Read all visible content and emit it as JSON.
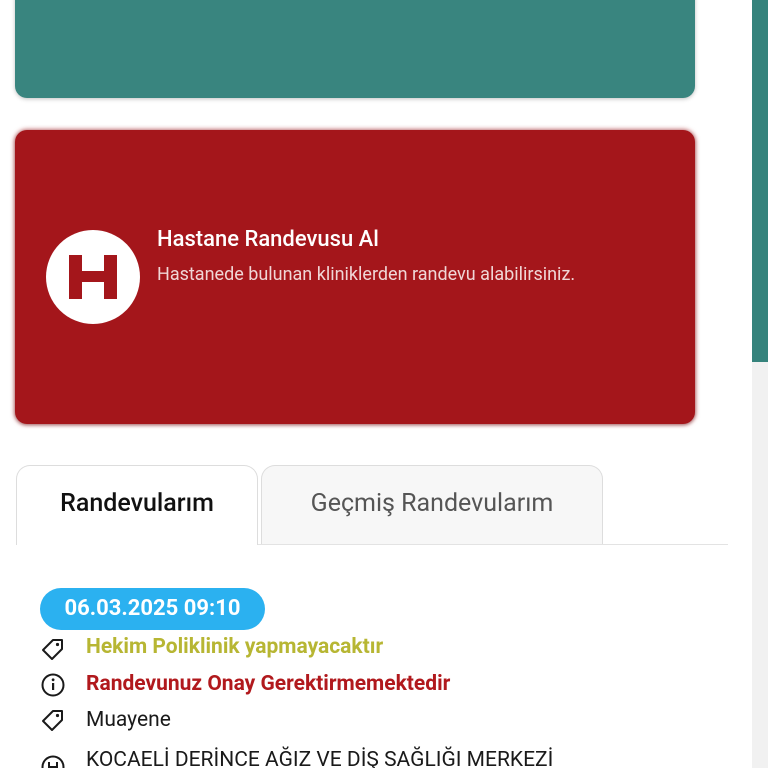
{
  "hospital_card": {
    "title": "Hastane Randevusu Al",
    "subtitle": "Hastanede bulunan kliniklerden randevu alabilirsiniz.",
    "icon": "hospital-h-icon"
  },
  "tabs": [
    {
      "label": "Randevularım",
      "active": true
    },
    {
      "label": "Geçmiş Randevularım",
      "active": false
    }
  ],
  "appointment": {
    "datetime": "06.03.2025 09:10",
    "doctor_status": "Hekim Poliklinik yapmayacaktır",
    "approval_status": "Randevunuz Onay Gerektirmemektedir",
    "type": "Muayene",
    "hospital": "KOCAELİ DERİNCE AĞIZ VE DİŞ SAĞLIĞI MERKEZİ"
  },
  "colors": {
    "teal": "#39857f",
    "red": "#a4161b",
    "date_pill": "#2bb1f0",
    "olive_text": "#b7b633",
    "red_text": "#b1191d"
  }
}
